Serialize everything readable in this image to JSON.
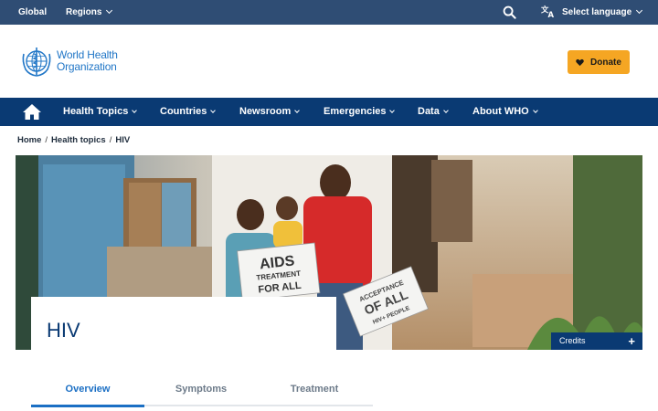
{
  "topbar": {
    "global_label": "Global",
    "regions_label": "Regions",
    "language_label": "Select language"
  },
  "header": {
    "logo_line1": "World Health",
    "logo_line2": "Organization",
    "donate_label": "Donate"
  },
  "nav": {
    "items": [
      {
        "label": "Health Topics"
      },
      {
        "label": "Countries"
      },
      {
        "label": "Newsroom"
      },
      {
        "label": "Emergencies"
      },
      {
        "label": "Data"
      },
      {
        "label": "About WHO"
      }
    ]
  },
  "breadcrumb": {
    "items": [
      "Home",
      "Health topics",
      "HIV"
    ],
    "separator": "/"
  },
  "hero": {
    "title": "HIV",
    "credits_label": "Credits",
    "sign_left_line1": "AIDS",
    "sign_left_line2": "TREATMENT",
    "sign_left_line3": "FOR ALL",
    "sign_right_line1": "ACCEPTANCE",
    "sign_right_line2": "OF ALL",
    "sign_right_line3": "HIV+ PEOPLE"
  },
  "tabs": {
    "items": [
      {
        "label": "Overview",
        "active": true
      },
      {
        "label": "Symptoms",
        "active": false
      },
      {
        "label": "Treatment",
        "active": false
      }
    ]
  },
  "colors": {
    "topbar": "#2f4d74",
    "nav": "#0a3a73",
    "donate": "#f5a623",
    "who_blue": "#2277c7",
    "tab_active": "#1b6fc4"
  },
  "icons": {
    "search": "search-icon",
    "language": "translate-icon",
    "home": "home-icon",
    "heart": "heart-icon",
    "plus": "plus-icon"
  }
}
